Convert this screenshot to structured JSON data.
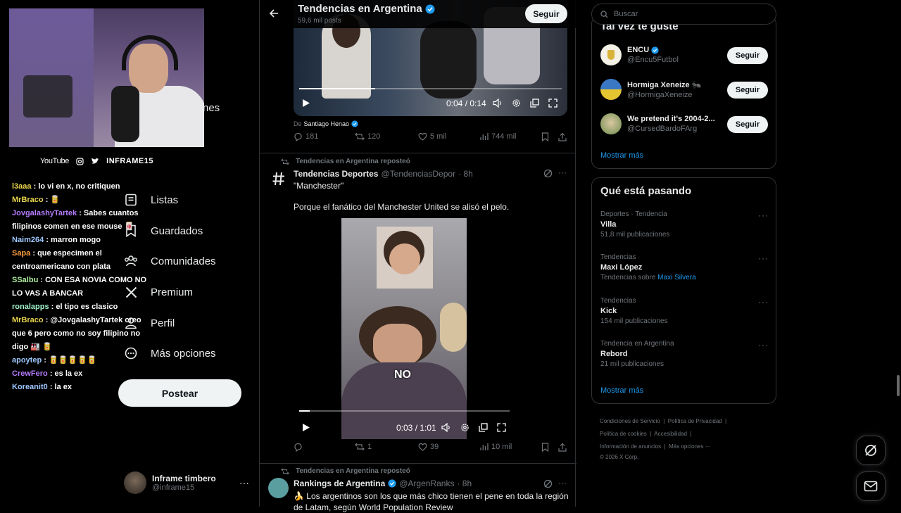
{
  "nav": {
    "items": [
      {
        "label": "Listas",
        "icon": "list-icon"
      },
      {
        "label": "Guardados",
        "icon": "bookmark-icon"
      },
      {
        "label": "Comunidades",
        "icon": "communities-icon"
      },
      {
        "label": "Premium",
        "icon": "x-logo-icon"
      },
      {
        "label": "Perfil",
        "icon": "profile-icon"
      },
      {
        "label": "Más opciones",
        "icon": "more-circle-icon"
      }
    ],
    "partial_label": "nes",
    "post_label": "Postear",
    "account": {
      "name": "Inframe timbero",
      "handle": "@inframe15"
    }
  },
  "overlay": {
    "youtube": "YouTube",
    "channel": "INFRAME15"
  },
  "chat": [
    {
      "user": "l3aaa",
      "color": "#e8d44d",
      "msg": ": lo vi en x, no critiquen"
    },
    {
      "user": "MrBraco",
      "color": "#e8d44d",
      "msg": ": 🥫"
    },
    {
      "user": "JovgalashyTartek",
      "color": "#b57cff",
      "msg": ": Sabes cuantos filipinos comen en ese mouse 🀄"
    },
    {
      "user": "Naim264",
      "color": "#9ec8ff",
      "msg": ": marron mogo"
    },
    {
      "user": "Sapa",
      "color": "#ff9f40",
      "msg": ": que especimen el centroamericano con plata"
    },
    {
      "user": "SSalbu",
      "color": "#b0f0a0",
      "msg": ": CON ESA NOVIA COMO NO LO VAS A BANCAR"
    },
    {
      "user": "ronalapps",
      "color": "#a0f0c8",
      "msg": ": el tipo es clasico"
    },
    {
      "user": "MrBraco",
      "color": "#e8d44d",
      "msg": ": @JovgalashyTartek creo que 6 pero como no soy filipino no digo 🏭 🥫"
    },
    {
      "user": "apoytep",
      "color": "#9ec8ff",
      "msg": ": 🥫🥫🥫🥫🥫"
    },
    {
      "user": "CrewFero",
      "color": "#b57cff",
      "msg": ": es la ex"
    },
    {
      "user": "Koreanit0",
      "color": "#9ec8ff",
      "msg": ": la ex"
    }
  ],
  "header": {
    "title": "Tendencias en Argentina",
    "subtitle": "59,6 mil posts",
    "follow_label": "Seguir"
  },
  "tweet1": {
    "video_time": "0:04 / 0:14",
    "source_prefix": "De",
    "source_name": "Santiago Henao",
    "replies": "181",
    "reposts": "120",
    "likes": "5 mil",
    "views": "744 mil"
  },
  "tweet2": {
    "repost_label": "Tendencias en Argentina reposteó",
    "name": "Tendencias Deportes",
    "handle": "@TendenciasDepor",
    "time": "· 8h",
    "line1": "\"Manchester\"",
    "line2": "Porque el fanático del Manchester United se alisó el pelo.",
    "overlay_text": "NO",
    "video_time": "0:03 / 1:01",
    "replies": "",
    "reposts": "1",
    "likes": "39",
    "views": "10 mil"
  },
  "tweet3": {
    "repost_label": "Tendencias en Argentina reposteó",
    "name": "Rankings de Argentina",
    "handle": "@ArgenRanks",
    "time": "· 8h",
    "text": "🍌 Los argentinos son los que más chico tienen el pene en toda la región de Latam, según World Population Review"
  },
  "search": {
    "placeholder": "Buscar"
  },
  "suggest": {
    "heading": "Tal vez te guste",
    "accounts": [
      {
        "name": "ENCU",
        "handle": "@Encu5Futbol",
        "follow": "Seguir",
        "verified": true
      },
      {
        "name": "Hormiga Xeneize 🐜",
        "handle": "@HormigaXeneize",
        "follow": "Seguir",
        "verified": false
      },
      {
        "name": "We pretend it's 2004-2...",
        "handle": "@CursedBardoFArg",
        "follow": "Seguir",
        "verified": false
      }
    ],
    "more": "Mostrar más"
  },
  "trends": {
    "heading": "Qué está pasando",
    "items": [
      {
        "context": "Deportes · Tendencia",
        "title": "Villa",
        "meta": "51,8 mil publicaciones",
        "link": ""
      },
      {
        "context": "Tendencias",
        "title": "Maxi López",
        "meta": "Tendencias sobre",
        "link": "Maxi Silvera"
      },
      {
        "context": "Tendencias",
        "title": "Kick",
        "meta": "154 mil publicaciones",
        "link": ""
      },
      {
        "context": "Tendencia en Argentina",
        "title": "Rebord",
        "meta": "21 mil publicaciones",
        "link": ""
      }
    ],
    "more": "Mostrar más"
  },
  "footer": {
    "links": [
      "Condiciones de Servicio",
      "Política de Privacidad",
      "Política de cookies",
      "Accesibilidad",
      "Información de anuncios",
      "Más opciones ···"
    ],
    "copyright": "© 2026 X Corp."
  },
  "colors": {
    "accent": "#1d9bf0",
    "border": "#2f3336",
    "muted": "#71767b"
  }
}
